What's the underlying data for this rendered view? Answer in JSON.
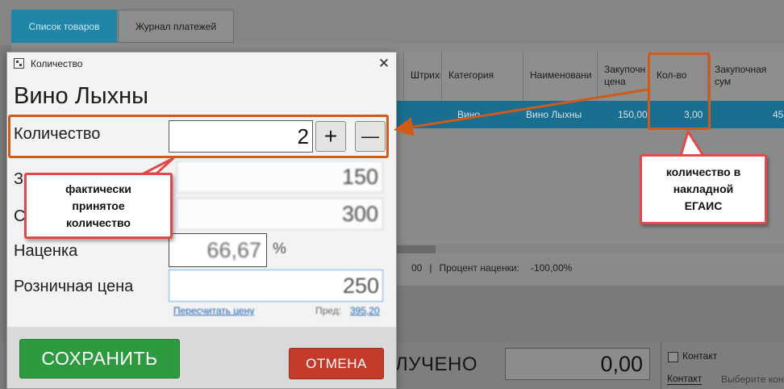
{
  "tabs": [
    {
      "label": "Список товаров"
    },
    {
      "label": "Журнал платежей"
    }
  ],
  "grid": {
    "columns": [
      {
        "label": "Штрихк"
      },
      {
        "label": "Категория"
      },
      {
        "label": "Наименовани"
      },
      {
        "label": "Закупочн цена"
      },
      {
        "label": "Кол-во"
      },
      {
        "label": "Закупочная сум"
      }
    ],
    "row": {
      "category": "Вино",
      "name": "Вино Лыхны",
      "price": "150,00",
      "qty": "3,00",
      "sum": "45"
    }
  },
  "status_bar": {
    "value_tail": "00",
    "separator": "|",
    "markup_label": "Процент наценки:",
    "markup_value": "-100,00%"
  },
  "bottom": {
    "received_label": "ЛУЧЕНО",
    "received_amount": "0,00",
    "contact_checkbox_label": "Контакт",
    "contact_tab_label": "Контакт",
    "contact_hint": "Выберите конт"
  },
  "dialog": {
    "title": "Количество",
    "close_glyph": "✕",
    "product_name": "Вино Лыхны",
    "quantity_label": "Количество",
    "quantity_value": "2",
    "plus_glyph": "+",
    "minus_glyph": "—",
    "purchase_label_fragment": "З",
    "purchase_price": "150",
    "sum_label_fragment": "С",
    "sum_value": "300",
    "markup_label": "Наценка",
    "markup_value": "66,67",
    "markup_unit": "%",
    "retail_label": "Розничная цена",
    "retail_value": "250",
    "recalc_link": "Пересчитать цену",
    "prev_label": "Пред:",
    "prev_value": "395,20",
    "save_label": "СОХРАНИТЬ",
    "cancel_label": "ОТМЕНА"
  },
  "annotations": {
    "actual_qty_callout": "фактически\nпринятое\nколичество",
    "egais_qty_callout": "количество в\nнакладной\nЕГАИС",
    "frame_color": "#d05a17",
    "callout_border_color": "#df4a4a"
  },
  "colors": {
    "active_tab": "#1f86a8",
    "save_button": "#2e9a40",
    "cancel_button": "#c43b2c"
  }
}
